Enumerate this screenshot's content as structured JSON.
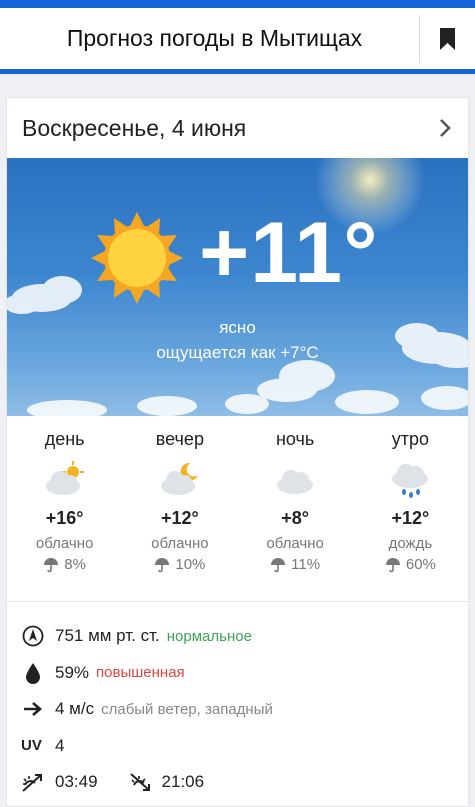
{
  "header": {
    "title": "Прогноз погоды в Мытищах",
    "bookmark_icon": "bookmark-icon"
  },
  "day": {
    "title": "Воскресенье, 4 июня",
    "current": {
      "temperature": "+11°",
      "condition": "ясно",
      "feels_like": "ощущается как +7°C",
      "icon": "sun-icon"
    },
    "periods": [
      {
        "name": "день",
        "icon": "partly-cloudy-day-icon",
        "temp": "+16°",
        "desc": "облачно",
        "precip": "8%"
      },
      {
        "name": "вечер",
        "icon": "partly-cloudy-night-icon",
        "temp": "+12°",
        "desc": "облачно",
        "precip": "10%"
      },
      {
        "name": "ночь",
        "icon": "cloud-icon",
        "temp": "+8°",
        "desc": "облачно",
        "precip": "11%"
      },
      {
        "name": "утро",
        "icon": "rain-cloud-icon",
        "temp": "+12°",
        "desc": "дождь",
        "precip": "60%"
      }
    ],
    "details": {
      "pressure": {
        "value": "751 мм рт. ст.",
        "status": "нормальное"
      },
      "humidity": {
        "value": "59%",
        "status": "повышенная"
      },
      "wind": {
        "value": "4 м/с",
        "desc": "слабый ветер, западный"
      },
      "uv": {
        "label": "UV",
        "value": "4"
      },
      "sunrise": "03:49",
      "sunset": "21:06"
    }
  },
  "colors": {
    "accent": "#1565d8",
    "normal": "#3aa454",
    "elevated": "#e0443f",
    "sun": "#ffcf3a",
    "sun_rays": "#f5a623"
  }
}
